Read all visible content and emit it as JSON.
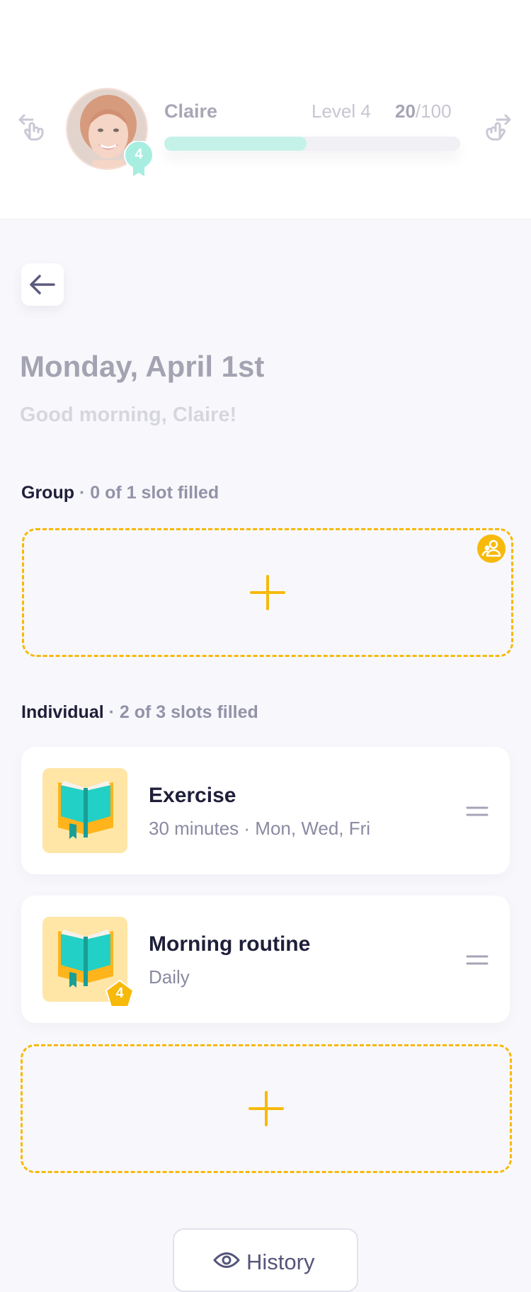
{
  "header": {
    "user_name": "Claire",
    "avatar_level": "4",
    "level_label": "Level 4",
    "score_current": "20",
    "score_separator": "/",
    "score_max": "100",
    "progress": 0.48,
    "nav_left_icon": "hand-pointing-back-icon",
    "nav_right_icon": "hand-pointing-forward-icon"
  },
  "page": {
    "date_title": "Monday, April 1st",
    "greeting": "Good morning, Claire!"
  },
  "group_section": {
    "label": "Group",
    "status": " · 0 of 1 slot filled"
  },
  "individual_section": {
    "label": "Individual",
    "status": " · 2 of 3 slots filled",
    "items": [
      {
        "title": "Exercise",
        "subtitle": "30 minutes · Mon, Wed, Fri",
        "badge": null
      },
      {
        "title": "Morning routine",
        "subtitle": "Daily",
        "badge": "4"
      }
    ]
  },
  "footer": {
    "history_label": "History"
  },
  "colors": {
    "accent": "#f7b90a",
    "progress_fill": "#c5f2e8",
    "badge_teal": "#a8eee0",
    "text_dark": "#1f1f3a",
    "text_muted": "#8a8aa2"
  }
}
